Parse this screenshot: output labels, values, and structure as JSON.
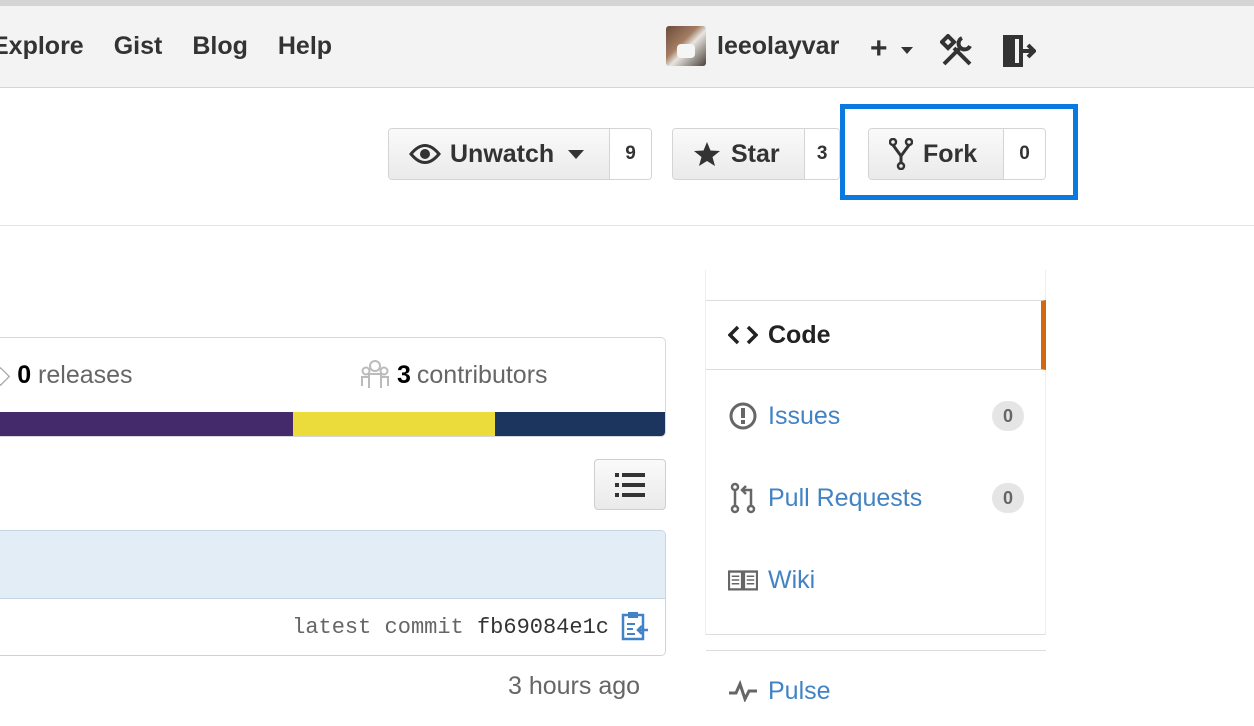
{
  "header": {
    "nav": [
      "Explore",
      "Gist",
      "Blog",
      "Help"
    ],
    "username": "leeolayvar",
    "plus_label": "+"
  },
  "repo_actions": {
    "watch": {
      "label": "Unwatch",
      "count": "9"
    },
    "star": {
      "label": "Star",
      "count": "3"
    },
    "fork": {
      "label": "Fork",
      "count": "0"
    },
    "highlight_color": "#0a79e0"
  },
  "summary": {
    "releases_count": "0",
    "releases_label": "releases",
    "contributors_count": "3",
    "contributors_label": "contributors",
    "language_colors": [
      "#452a6b",
      "#ecdc3b",
      "#1b355f"
    ]
  },
  "commit": {
    "label": "latest commit",
    "sha": "fb69084e1c",
    "time_ago": "3 hours ago"
  },
  "sidebar": {
    "items": [
      {
        "label": "Code",
        "icon": "code-icon"
      },
      {
        "label": "Issues",
        "icon": "issue-icon",
        "count": "0"
      },
      {
        "label": "Pull Requests",
        "icon": "pull-request-icon",
        "count": "0"
      },
      {
        "label": "Wiki",
        "icon": "book-icon"
      },
      {
        "label": "Pulse",
        "icon": "pulse-icon"
      }
    ],
    "selected_accent": "#d26911",
    "link_color": "#4183c4"
  }
}
